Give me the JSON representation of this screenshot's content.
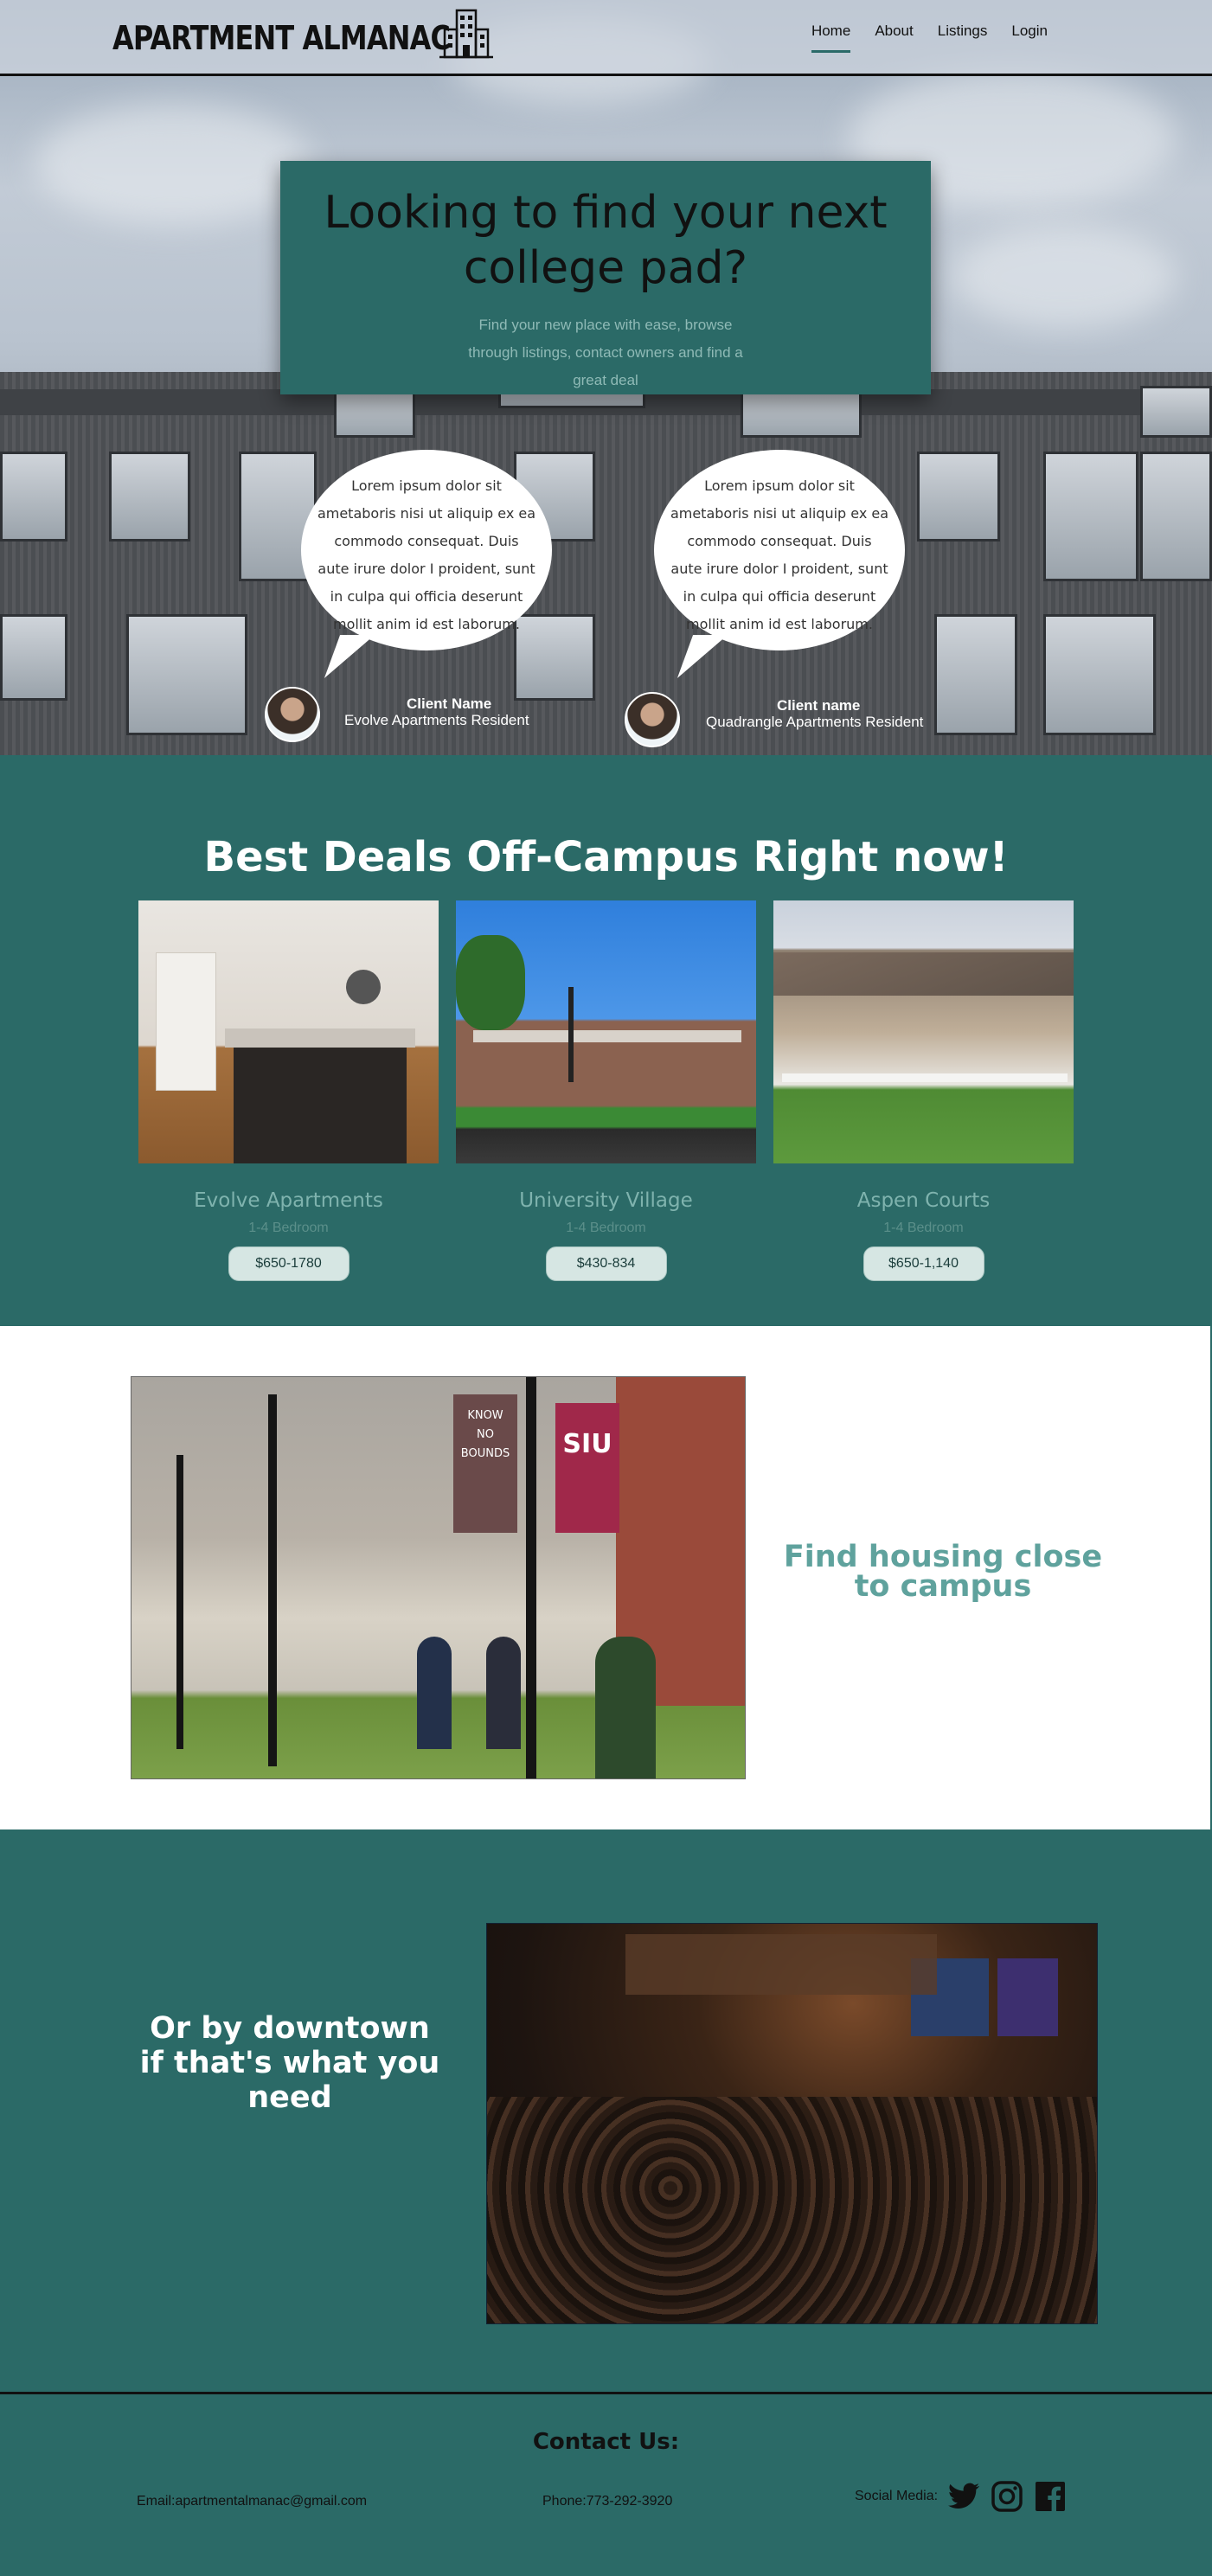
{
  "nav": {
    "logo_text": "APARTMENT ALMANAC",
    "links": [
      {
        "label": "Home",
        "active": true
      },
      {
        "label": "About",
        "active": false
      },
      {
        "label": "Listings",
        "active": false
      },
      {
        "label": "Login",
        "active": false
      }
    ]
  },
  "hero": {
    "title": "Looking to find your next college pad?",
    "subtitle": "Find your new place with ease, browse through listings, contact owners and find a great deal",
    "testimonials": [
      {
        "text": "Lorem ipsum dolor sit ametaboris nisi ut aliquip ex ea commodo consequat. Duis aute irure dolor I proident, sunt in culpa qui officia  deserunt mollit anim id est laborum.",
        "client_name": "Client Name",
        "client_role": "Evolve Apartments Resident"
      },
      {
        "text": "Lorem ipsum dolor sit ametaboris nisi ut aliquip ex ea commodo consequat. Duis aute irure dolor I proident, sunt in culpa qui officia  deserunt mollit anim id est laborum.",
        "client_name": "Client name",
        "client_role": "Quadrangle Apartments Resident"
      }
    ]
  },
  "deals": {
    "title": "Best Deals Off-Campus Right now!",
    "items": [
      {
        "name": "Evolve Apartments",
        "beds": "1-4 Bedroom",
        "price": "$650-1780"
      },
      {
        "name": "University Village",
        "beds": "1-4 Bedroom",
        "price": "$430-834"
      },
      {
        "name": "Aspen Courts",
        "beds": "1-4 Bedroom",
        "price": "$650-1,140"
      }
    ]
  },
  "campus": {
    "title": "Find housing close to campus",
    "banner_text_1": "SIU",
    "banner_text_2": "KNOW NO BOUNDS"
  },
  "downtown": {
    "title_line1": "Or by downtown",
    "title_line2": "if that's what you need"
  },
  "footer": {
    "contact_title": "Contact Us:",
    "email": "Email:apartmentalmanac@gmail.com",
    "phone": "Phone:773-292-3920",
    "social_label": "Social Media:"
  },
  "colors": {
    "primary_teal": "#2b6a67",
    "accent_light_teal": "#7fb3ae",
    "price_pill": "#d6e6e3"
  }
}
